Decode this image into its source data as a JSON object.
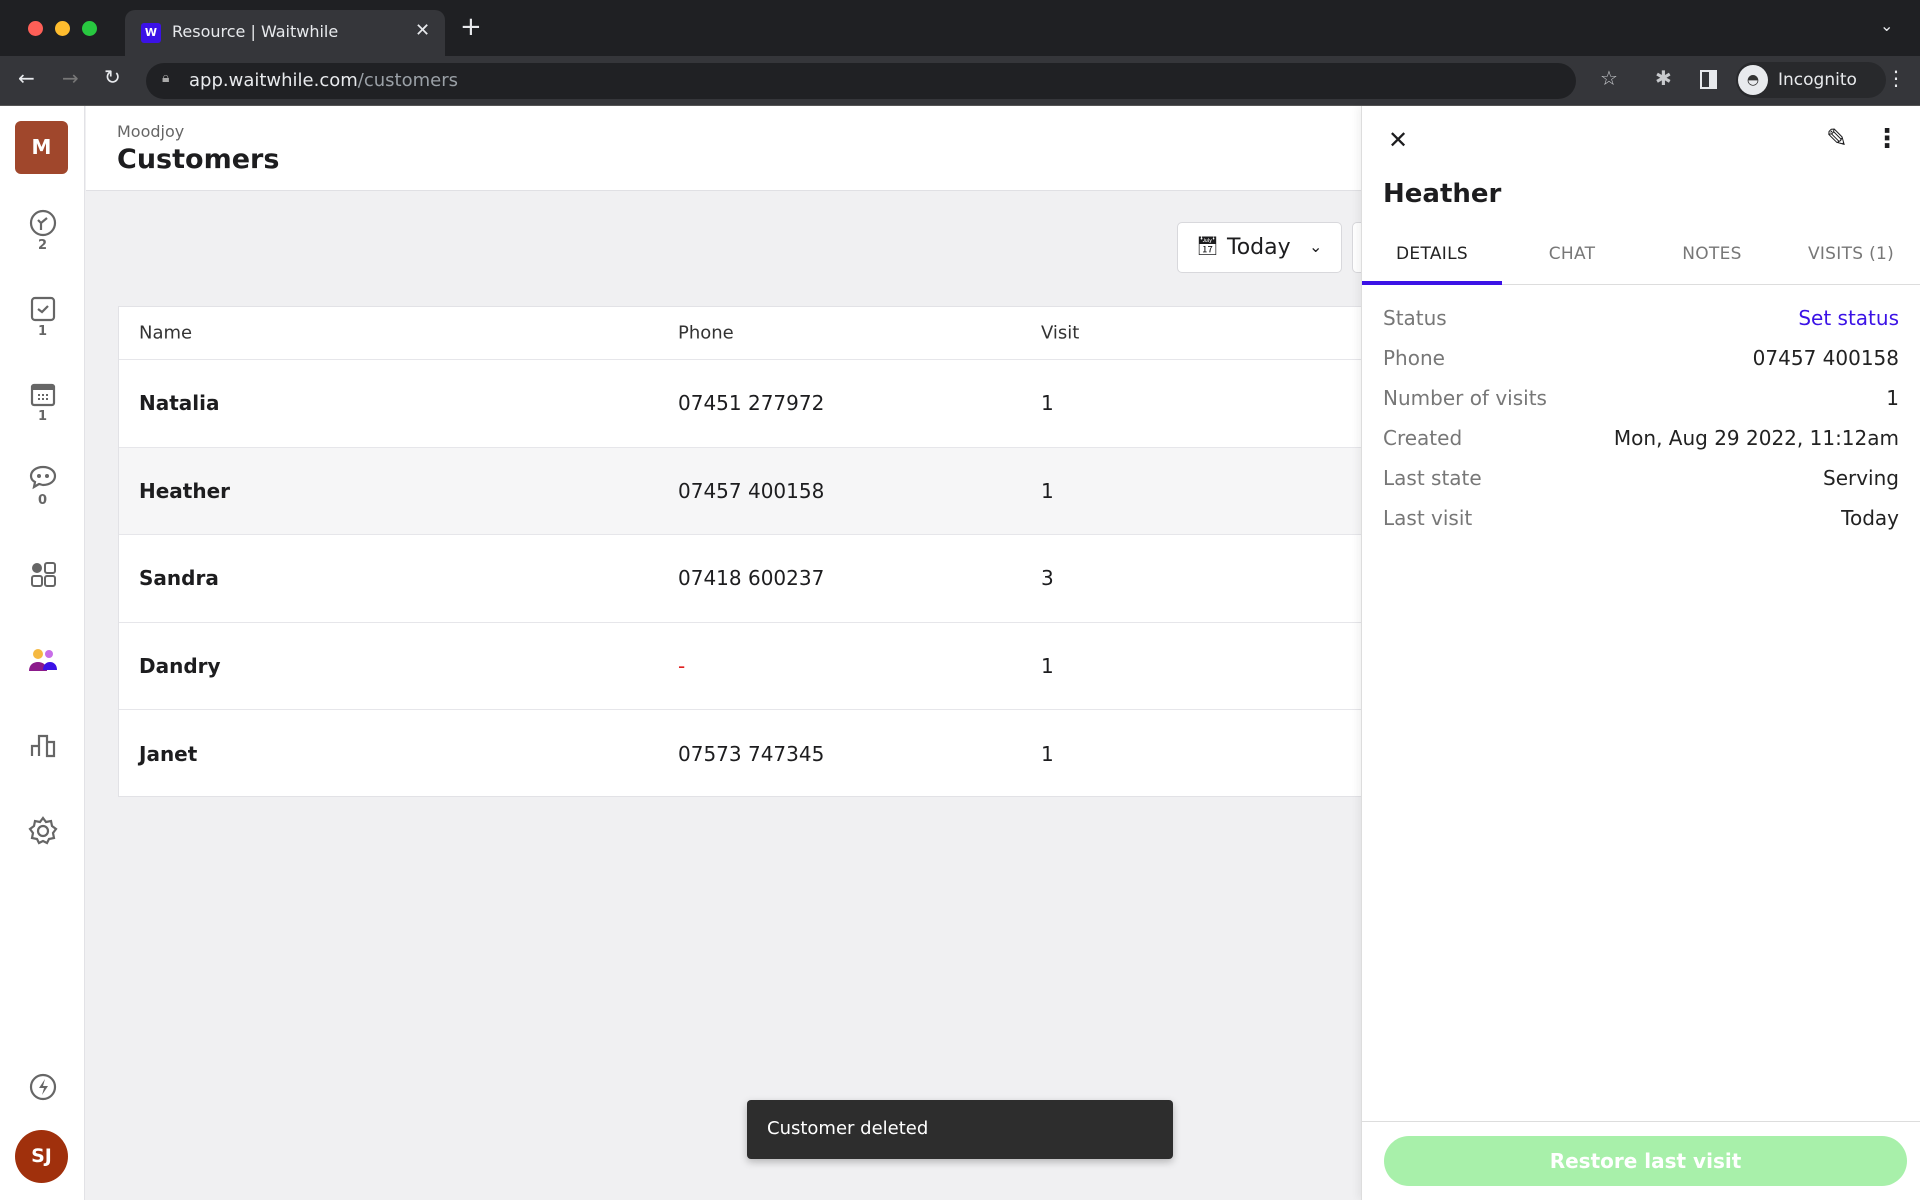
{
  "browser": {
    "tab_title": "Resource | Waitwhile",
    "url_host": "app.waitwhile.com",
    "url_path": "/customers",
    "profile": "Incognito"
  },
  "sidebar": {
    "org_initial": "M",
    "items": [
      {
        "icon": "waitlist-icon",
        "count": "2"
      },
      {
        "icon": "checkin-icon",
        "count": "1"
      },
      {
        "icon": "calendar-icon",
        "count": "1"
      },
      {
        "icon": "chat-icon",
        "count": "0"
      },
      {
        "icon": "apps-icon"
      },
      {
        "icon": "customers-icon"
      },
      {
        "icon": "analytics-icon"
      },
      {
        "icon": "settings-icon"
      }
    ],
    "user_initials": "SJ"
  },
  "header": {
    "org": "Moodjoy",
    "title": "Customers"
  },
  "filter": {
    "date_label": "Today"
  },
  "table": {
    "columns": [
      "Name",
      "Phone",
      "Visit"
    ],
    "rows": [
      {
        "name": "Natalia",
        "phone": "07451 277972",
        "visits": "1"
      },
      {
        "name": "Heather",
        "phone": "07457 400158",
        "visits": "1"
      },
      {
        "name": "Sandra",
        "phone": "07418 600237",
        "visits": "3"
      },
      {
        "name": "Dandry",
        "phone": "-",
        "visits": "1"
      },
      {
        "name": "Janet",
        "phone": "07573 747345",
        "visits": "1"
      }
    ]
  },
  "panel": {
    "name": "Heather",
    "tabs": [
      "DETAILS",
      "CHAT",
      "NOTES",
      "VISITS (1)"
    ],
    "active_tab": "DETAILS",
    "details": [
      {
        "label": "Status",
        "value": "Set status"
      },
      {
        "label": "Phone",
        "value": "07457 400158"
      },
      {
        "label": "Number of visits",
        "value": "1"
      },
      {
        "label": "Created",
        "value": "Mon, Aug 29 2022, 11:12am"
      },
      {
        "label": "Last state",
        "value": "Serving"
      },
      {
        "label": "Last visit",
        "value": "Today"
      }
    ],
    "restore_label": "Restore last visit"
  },
  "toast": "Customer deleted",
  "colors": {
    "accent": "#3b12e6",
    "org_avatar": "#a0472c",
    "restore_button": "#a8f0aa",
    "toast_bg": "#2d2d2d"
  }
}
